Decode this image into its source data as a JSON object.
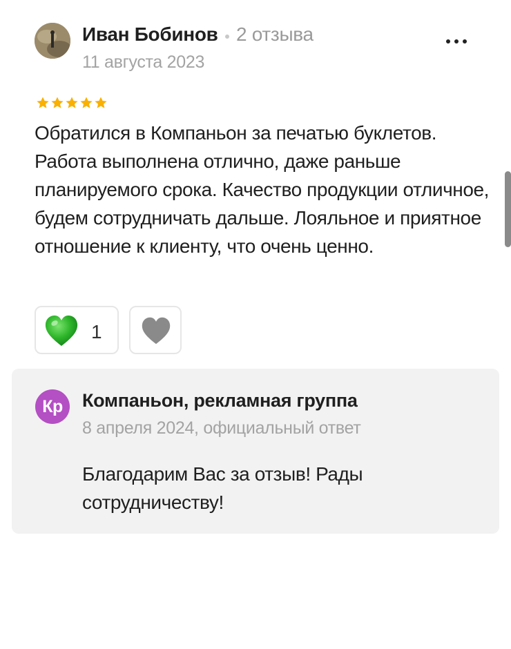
{
  "review": {
    "author": {
      "name": "Иван Бобинов",
      "reviews_count": "2 отзыва",
      "avatar": "user-photo"
    },
    "date": "11 августа 2023",
    "rating": 5,
    "rating_max": 5,
    "star_color": "#f9b000",
    "text": "Обратился в Компаньон за печатью буклетов. Работа выполнена отлично, даже раньше планируемого срока. Качество продукции отличное, будем сотрудничать дальше. Лояльное и приятное отношение к клиенту, что очень ценно.",
    "more_icon": "more-dots-icon",
    "reactions": {
      "like": {
        "icon": "green-heart-icon",
        "color": "#2db52a",
        "count": "1"
      },
      "dislike": {
        "icon": "grey-heart-icon",
        "color": "#8a8a8a"
      }
    }
  },
  "reply": {
    "avatar_text": "Кр",
    "avatar_color": "#b44fc4",
    "company_name": "Компаньон, рекламная группа",
    "meta": "8 апреля 2024, официальный ответ",
    "text": "Благодарим Вас за отзыв! Рады сотрудничеству!"
  }
}
